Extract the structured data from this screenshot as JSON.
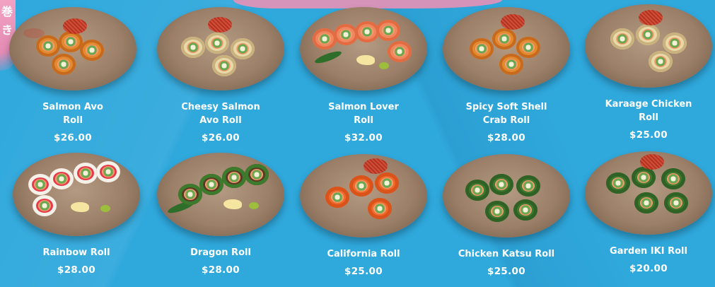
{
  "decor": {
    "kanji_lines": [
      "巻",
      "き"
    ]
  },
  "menu": {
    "items": [
      {
        "name_lines": [
          "Salmon Avo",
          "Roll"
        ],
        "price": "$26.00",
        "roll": "fried"
      },
      {
        "name_lines": [
          "Cheesy Salmon",
          "Avo Roll"
        ],
        "price": "$26.00",
        "roll": "sesame"
      },
      {
        "name_lines": [
          "Salmon Lover",
          "Roll"
        ],
        "price": "$32.00",
        "roll": "salmon"
      },
      {
        "name_lines": [
          "Spicy Soft Shell",
          "Crab Roll"
        ],
        "price": "$28.00",
        "roll": "fried"
      },
      {
        "name_lines": [
          "Karaage Chicken",
          "Roll"
        ],
        "price": "$25.00",
        "roll": "sesame"
      },
      {
        "name_lines": [
          "Rainbow Roll"
        ],
        "price": "$28.00",
        "roll": "rainbow"
      },
      {
        "name_lines": [
          "Dragon Roll"
        ],
        "price": "$28.00",
        "roll": "eel"
      },
      {
        "name_lines": [
          "California Roll"
        ],
        "price": "$25.00",
        "roll": "roe"
      },
      {
        "name_lines": [
          "Chicken Katsu Roll"
        ],
        "price": "$25.00",
        "roll": "green"
      },
      {
        "name_lines": [
          "Garden IKI Roll"
        ],
        "price": "$20.00",
        "roll": "green"
      }
    ]
  },
  "colors": {
    "background": "#2fa8dc",
    "accent_pink": "#e991b6",
    "text": "#ffffff"
  }
}
